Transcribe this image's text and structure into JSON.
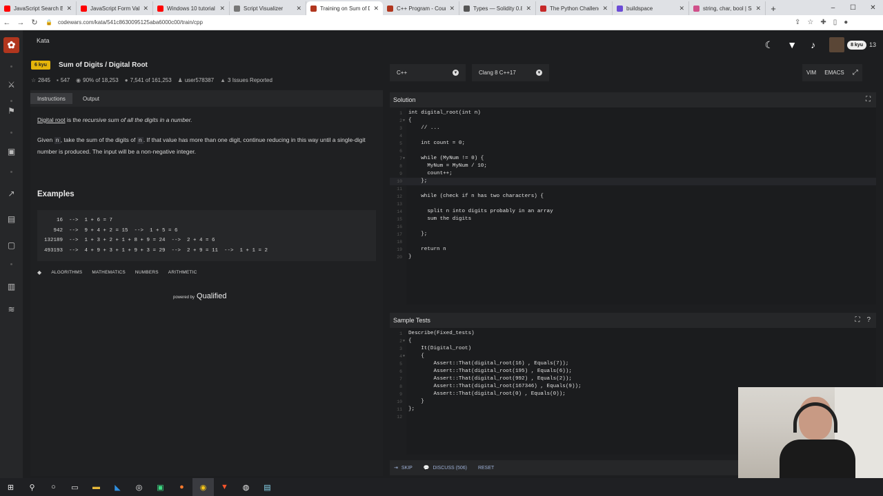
{
  "browser": {
    "tabs": [
      {
        "title": "JavaScript Search Ba",
        "color": "#ff0000"
      },
      {
        "title": "JavaScript Form Valid",
        "color": "#ff0000"
      },
      {
        "title": "Windows 10 tutorial",
        "color": "#ff0000"
      },
      {
        "title": "Script Visualizer",
        "color": "#777777"
      },
      {
        "title": "Training on Sum of D",
        "color": "#b1361e",
        "active": true
      },
      {
        "title": "C++ Program - Coun",
        "color": "#b1361e"
      },
      {
        "title": "Types — Solidity 0.8",
        "color": "#555555"
      },
      {
        "title": "The Python Challeng",
        "color": "#c62828"
      },
      {
        "title": "buildspace",
        "color": "#6b4bd6"
      },
      {
        "title": "string, char, bool | Sc",
        "color": "#d0508a"
      }
    ],
    "url": "codewars.com/kata/541c8630095125aba6000c00/train/cpp"
  },
  "nav": {
    "kata_link": "Kata",
    "rank_pill": "8 kyu",
    "honor": "13"
  },
  "kata": {
    "rank": "6 kyu",
    "title": "Sum of Digits / Digital Root",
    "stats": {
      "stars": "2845",
      "watchers": "547",
      "satisfaction": "90% of 18,253",
      "completed": "7,541 of 161,253",
      "author": "user578387",
      "issues": "3 Issues Reported"
    }
  },
  "left_tabs": {
    "instructions": "Instructions",
    "output": "Output"
  },
  "description": {
    "p1_link": "Digital root",
    "p1_mid": " is the ",
    "p1_em": "recursive sum of all the digits in a number.",
    "p2_a": "Given ",
    "p2_code": "n",
    "p2_b": ", take the sum of the digits of ",
    "p2_code2": "n",
    "p2_c": ". If that value has more than one digit, continue reducing in this way until a single-digit number is produced. The input will be a non-negative integer."
  },
  "examples": {
    "heading": "Examples",
    "lines": [
      "    16  -->  1 + 6 = 7",
      "   942  -->  9 + 4 + 2 = 15  -->  1 + 5 = 6",
      "132189  -->  1 + 3 + 2 + 1 + 8 + 9 = 24  -->  2 + 4 = 6",
      "493193  -->  4 + 9 + 3 + 1 + 9 + 3 = 29  -->  2 + 9 = 11  -->  1 + 1 = 2"
    ]
  },
  "tags": [
    "ALGORITHMS",
    "MATHEMATICS",
    "NUMBERS",
    "ARITHMETIC"
  ],
  "powered": {
    "small": "powered by",
    "brand": "Qualified"
  },
  "selectors": {
    "language": "C++",
    "version": "Clang 8 C++17"
  },
  "modes": {
    "vim": "VIM",
    "emacs": "EMACS"
  },
  "solution": {
    "title": "Solution",
    "lines": [
      "int digital_root(int n)",
      "{",
      "    // ...",
      "",
      "    int count = 0;",
      "",
      "    while (MyNum != 0) {",
      "      MyNum = MyNum / 10;",
      "      count++;",
      "    };",
      "",
      "    while (check if n has two characters) {",
      "",
      "      split n into digits probably in an array",
      "      sum the digits",
      "",
      "    };",
      "",
      "    return n",
      "}"
    ]
  },
  "tests": {
    "title": "Sample Tests",
    "lines": [
      "Describe(Fixed_tests)",
      "{",
      "    It(Digital_root)",
      "    {",
      "        Assert::That(digital_root(16) , Equals(7));",
      "        Assert::That(digital_root(195) , Equals(6));",
      "        Assert::That(digital_root(992) , Equals(2));",
      "        Assert::That(digital_root(167346) , Equals(9));",
      "        Assert::That(digital_root(0) , Equals(0));",
      "    }",
      "};",
      ""
    ]
  },
  "actions": {
    "skip": "SKIP",
    "discuss": "DISCUSS (506)",
    "reset": "RESET"
  }
}
